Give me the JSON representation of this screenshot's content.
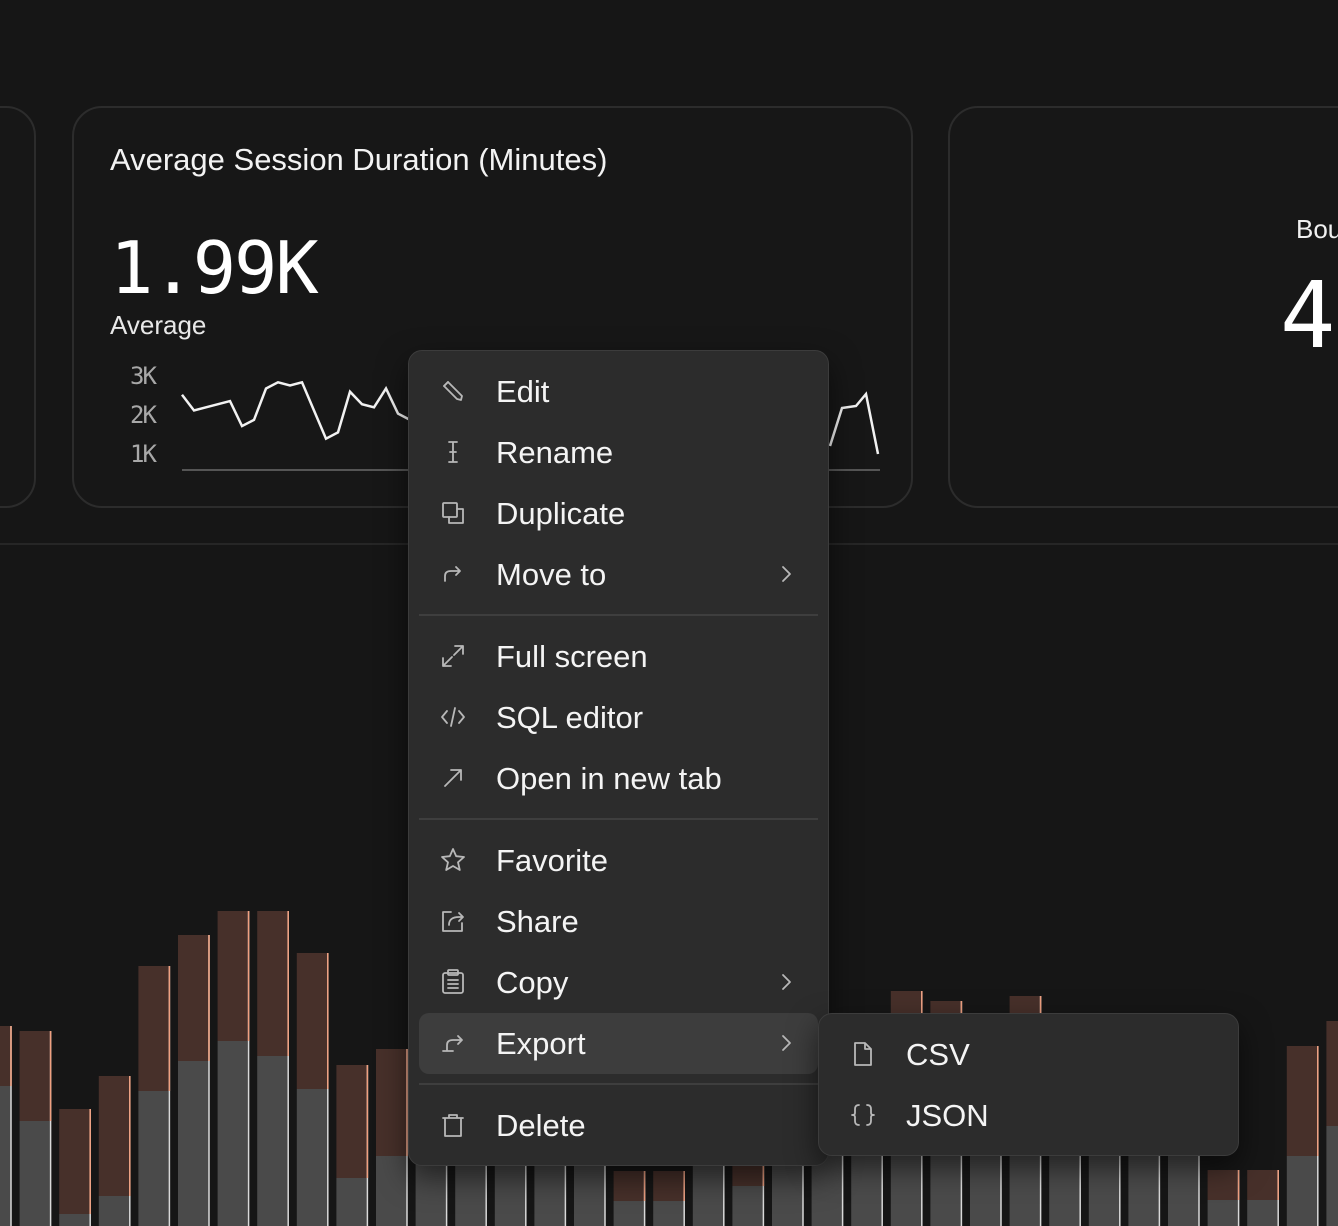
{
  "cards": {
    "main": {
      "title": "Average Session Duration (Minutes)",
      "value": "1.99K",
      "value_label": "Average",
      "y_ticks": [
        "3K",
        "2K",
        "1K"
      ],
      "sparkline": [
        2400,
        1900,
        2000,
        2100,
        2200,
        1400,
        1600,
        2600,
        2800,
        2700,
        2800,
        1900,
        1000,
        1200,
        2500,
        2100,
        2000,
        2600,
        1800,
        1600
      ]
    },
    "right": {
      "title": "Bou",
      "value": "4"
    }
  },
  "context_menu": {
    "groups": [
      [
        {
          "label": "Edit",
          "icon": "pencil-icon"
        },
        {
          "label": "Rename",
          "icon": "text-cursor-icon"
        },
        {
          "label": "Duplicate",
          "icon": "duplicate-icon"
        },
        {
          "label": "Move to",
          "icon": "redo-arrow-icon",
          "submenu": true
        }
      ],
      [
        {
          "label": "Full screen",
          "icon": "expand-icon"
        },
        {
          "label": "SQL editor",
          "icon": "code-icon"
        },
        {
          "label": "Open in new tab",
          "icon": "arrow-up-right-icon"
        }
      ],
      [
        {
          "label": "Favorite",
          "icon": "star-icon"
        },
        {
          "label": "Share",
          "icon": "share-icon"
        },
        {
          "label": "Copy",
          "icon": "clipboard-icon",
          "submenu": true
        },
        {
          "label": "Export",
          "icon": "export-icon",
          "submenu": true,
          "active": true
        }
      ],
      [
        {
          "label": "Delete",
          "icon": "trash-icon"
        }
      ]
    ]
  },
  "export_submenu": {
    "items": [
      {
        "label": "CSV",
        "icon": "file-icon"
      },
      {
        "label": "JSON",
        "icon": "braces-icon"
      }
    ]
  },
  "bar_chart": {
    "series": [
      {
        "name": "base",
        "color": "#4a4a4a"
      },
      {
        "name": "top",
        "color": "#47302a",
        "edge": "#f0a080"
      }
    ],
    "base": [
      140,
      105,
      12,
      30,
      135,
      165,
      185,
      170,
      137,
      48,
      70,
      90,
      100,
      105,
      110,
      115,
      25,
      25,
      60,
      40,
      95,
      100,
      105,
      110,
      130,
      135,
      150,
      145,
      110,
      95,
      80,
      26,
      26,
      70,
      100,
      130,
      120,
      125,
      40,
      10,
      20,
      35,
      185,
      190
    ],
    "top": [
      60,
      90,
      105,
      120,
      125,
      126,
      130,
      145,
      136,
      113,
      107,
      100,
      95,
      90,
      85,
      95,
      30,
      30,
      70,
      80,
      95,
      103,
      105,
      125,
      95,
      70,
      80,
      55,
      85,
      86,
      90,
      30,
      30,
      110,
      105,
      90,
      95,
      88,
      90,
      22,
      20,
      15,
      20,
      35
    ]
  }
}
